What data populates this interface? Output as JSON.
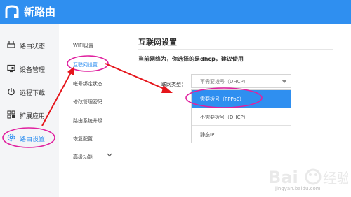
{
  "header": {
    "app_title": "新路由",
    "brand_color": "#2f8ff0"
  },
  "sidebar": {
    "items": [
      {
        "label": "路由状态",
        "icon": "router-icon",
        "active": false
      },
      {
        "label": "设备管理",
        "icon": "monitor-icon",
        "active": false
      },
      {
        "label": "远程下载",
        "icon": "power-icon",
        "active": false
      },
      {
        "label": "扩展应用",
        "icon": "grid-icon",
        "active": false
      },
      {
        "label": "路由设置",
        "icon": "gear-icon",
        "active": true
      }
    ]
  },
  "submenu": {
    "items": [
      {
        "label": "WIFI设置",
        "active": false
      },
      {
        "label": "互联网设置",
        "active": true
      },
      {
        "label": "帐号绑定状态",
        "active": false
      },
      {
        "label": "修改管理密码",
        "active": false
      },
      {
        "label": "路由系统升级",
        "active": false
      },
      {
        "label": "恢复配置",
        "active": false
      },
      {
        "label": "高级功能",
        "active": false
      }
    ]
  },
  "main": {
    "title": "互联网设置",
    "notice": "当前网络为，你选择的是dhcp，建议使用",
    "connection_type_label": "联网类型：",
    "select_value": "不需要拨号（DHCP）",
    "options": [
      {
        "label": "需要拨号（PPPoE）",
        "highlighted": true
      },
      {
        "label": "不需要拨号（DHCP）",
        "highlighted": false
      },
      {
        "label": "静态IP",
        "highlighted": false
      }
    ]
  },
  "watermark": {
    "text": "jingyan.baidu.com",
    "logo": "baidu-logo"
  },
  "annotation_color": "#e0219f",
  "arrow_color": "#e5151b"
}
